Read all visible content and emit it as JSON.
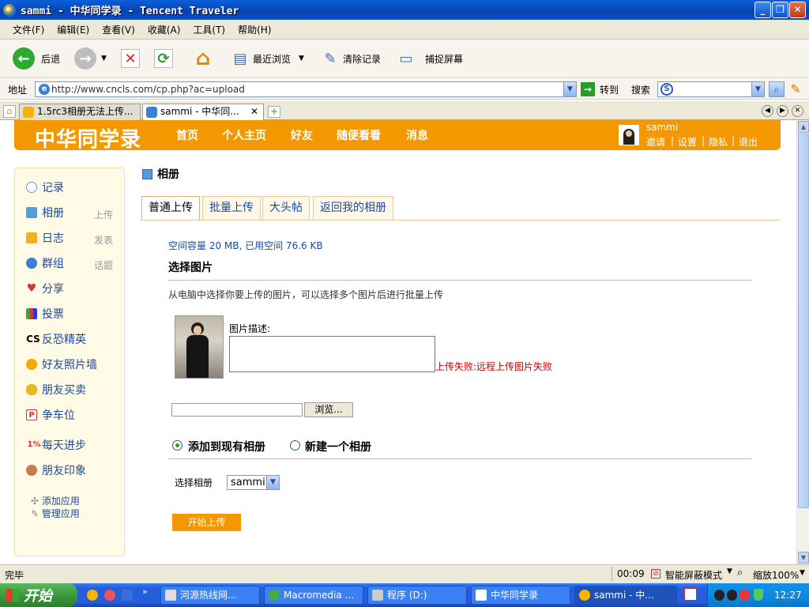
{
  "window": {
    "title": "sammi - 中华同学录 - Tencent Traveler"
  },
  "menu": [
    "文件(F)",
    "编辑(E)",
    "查看(V)",
    "收藏(A)",
    "工具(T)",
    "帮助(H)"
  ],
  "toolbar": {
    "back": "后退",
    "recent": "最近浏览",
    "clear": "清除记录",
    "capture": "捕捉屏幕"
  },
  "address": {
    "label": "地址",
    "url": "http://www.cncls.com/cp.php?ac=upload",
    "go": "转到",
    "search": "搜索"
  },
  "tabs": [
    {
      "label": "1.5rc3相册无法上传..."
    },
    {
      "label": "sammi - 中华同..."
    }
  ],
  "site": {
    "logo": "中华同学录",
    "nav": [
      "首页",
      "个人主页",
      "好友",
      "随便看看",
      "消息"
    ],
    "user": {
      "name": "sammi",
      "links": [
        "邀请",
        "设置",
        "隐私",
        "退出"
      ],
      "sep": "|"
    }
  },
  "sidebar": {
    "items": [
      {
        "label": "记录",
        "side": ""
      },
      {
        "label": "相册",
        "side": "上传"
      },
      {
        "label": "日志",
        "side": "发表"
      },
      {
        "label": "群组",
        "side": "话题"
      },
      {
        "label": "分享",
        "side": ""
      },
      {
        "label": "投票",
        "side": ""
      },
      {
        "label": "反恐精英",
        "side": ""
      },
      {
        "label": "好友照片墙",
        "side": ""
      },
      {
        "label": "朋友买卖",
        "side": ""
      },
      {
        "label": "争车位",
        "side": ""
      },
      {
        "label": "每天进步",
        "side": ""
      },
      {
        "label": "朋友印象",
        "side": ""
      }
    ],
    "icon_texts": {
      "cs": "CS",
      "pct": "1%"
    },
    "add_app": "添加应用",
    "manage_app": "管理应用"
  },
  "main": {
    "title": "相册",
    "tabs": [
      "普通上传",
      "批量上传",
      "大头帖",
      "返回我的相册"
    ],
    "quota": "空间容量 20 MB, 已用空间 76.6 KB",
    "section_title": "选择图片",
    "hint": "从电脑中选择你要上传的图片，可以选择多个图片后进行批量上传",
    "desc_label": "图片描述:",
    "error": "上传失败:远程上传图片失败",
    "browse": "浏览...",
    "radio_existing": "添加到现有相册",
    "radio_new": "新建一个相册",
    "select_label": "选择相册",
    "select_value": "sammi",
    "submit": "开始上传"
  },
  "status": {
    "text": "完毕",
    "time": "00:09",
    "block": "智能屏蔽模式",
    "zoom": "缩放100%"
  },
  "taskbar": {
    "start": "开始",
    "tasks": [
      "河源热线网...",
      "Macromedia ...",
      "程序 (D:)",
      "中华同学录",
      "sammi - 中..."
    ],
    "clock": "12:27"
  },
  "colors": {
    "brand": "#f39800",
    "link": "#1a4a9e",
    "error": "#cc0000"
  }
}
